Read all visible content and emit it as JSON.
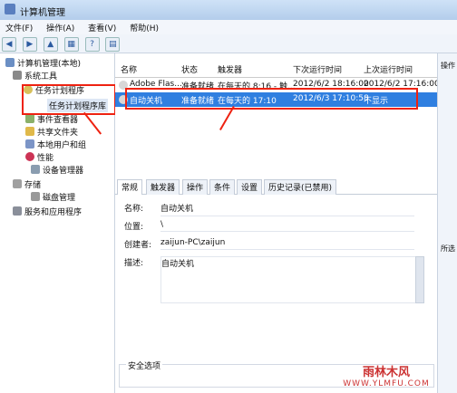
{
  "window": {
    "title": "计算机管理"
  },
  "menu": [
    "文件(F)",
    "操作(A)",
    "查看(V)",
    "帮助(H)"
  ],
  "tree": {
    "root": "计算机管理(本地)",
    "system_tools": "系统工具",
    "task_scheduler": "任务计划程序",
    "task_library": "任务计划程序库",
    "event_viewer": "事件查看器",
    "shared_folders": "共享文件夹",
    "local_users": "本地用户和组",
    "performance": "性能",
    "device_manager": "设备管理器",
    "storage": "存储",
    "disk_management": "磁盘管理",
    "services": "服务和应用程序"
  },
  "grid": {
    "headers": [
      "名称",
      "状态",
      "触发器",
      "下次运行时间",
      "上次运行时间"
    ],
    "rows": [
      [
        "Adobe Flas...",
        "准备就绪",
        "在每天的 8:16 - 触...",
        "2012/6/2 18:16:00",
        "2012/6/2 17:16:00"
      ],
      [
        "自动关机",
        "准备就绪",
        "在每天的 17:10",
        "2012/6/3 17:10:58",
        "不显示"
      ]
    ]
  },
  "tabs": [
    "常规",
    "触发器",
    "操作",
    "条件",
    "设置",
    "历史记录(已禁用)"
  ],
  "form": {
    "name_label": "名称:",
    "name_value": "自动关机",
    "location_label": "位置:",
    "location_value": "\\",
    "author_label": "创建者:",
    "author_value": "zaijun-PC\\zaijun",
    "desc_label": "描述:",
    "desc_value": "自动关机",
    "security_label": "安全选项"
  },
  "right_panel": {
    "ops": "操作",
    "sel": "所选"
  },
  "watermark": {
    "line1": "雨林木风",
    "line2": "WWW.YLMFU.COM"
  },
  "colors": {
    "selection": "#2f7fe0",
    "annotation": "#e21"
  }
}
